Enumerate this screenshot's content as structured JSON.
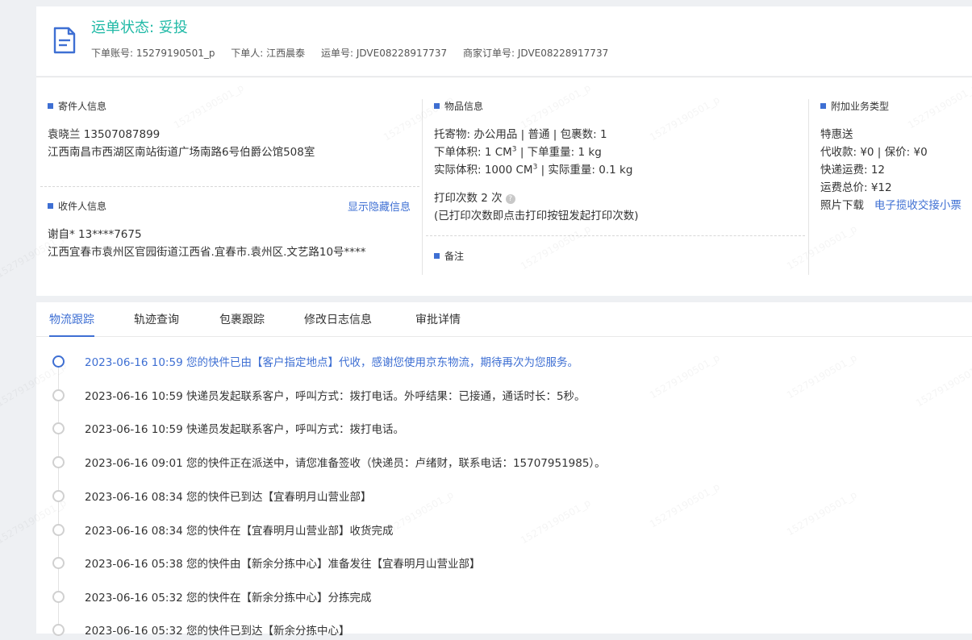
{
  "header": {
    "status_label": "运单状态: 妥投",
    "account": "下单账号: 15279190501_p",
    "orderer": "下单人: 江西晨泰",
    "waybill": "运单号: JDVE08228917737",
    "merchant_order": "商家订单号: JDVE08228917737"
  },
  "sender": {
    "title": "寄件人信息",
    "name_phone": "袁晓兰    13507087899",
    "address": "江西南昌市西湖区南站街道广场南路6号伯爵公馆508室"
  },
  "receiver": {
    "title": "收件人信息",
    "show_hidden": "显示隐藏信息",
    "name_phone": "谢自*    13****7675",
    "address": "江西宜春市袁州区官园街道江西省.宜春市.袁州区.文艺路10号****"
  },
  "goods": {
    "title": "物品信息",
    "line1": "托寄物:  办公用品 | 普通  |  包裹数:  1",
    "order_volume": "下单体积:   1 CM",
    "order_weight": " |  下单重量:   1 kg",
    "actual_volume": "实际体积:    1000 CM",
    "actual_weight": " |  实际重量:   0.1 kg",
    "cube": "3",
    "print_count": "打印次数    2 次",
    "print_note": "(已打印次数即点击打印按钮发起打印次数)",
    "remark_title": "备注"
  },
  "addon": {
    "title": "附加业务类型",
    "service": "特惠送",
    "cod": "代收款:  ¥0  |  保价:  ¥0",
    "freight": "快递运费:   12",
    "total": "运费总价:   ¥12",
    "photo_label": "照片下载",
    "photo_link": "电子揽收交接小票"
  },
  "tabs": [
    "物流跟踪",
    "轨迹查询",
    "包裹跟踪",
    "修改日志信息",
    "审批详情"
  ],
  "timeline": [
    "2023-06-16 10:59 您的快件已由【客户指定地点】代收，感谢您使用京东物流，期待再次为您服务。",
    "2023-06-16 10:59 快递员发起联系客户，呼叫方式：拨打电话。外呼结果：已接通，通话时长：5秒。",
    "2023-06-16 10:59 快递员发起联系客户，呼叫方式：拨打电话。",
    "2023-06-16 09:01 您的快件正在派送中，请您准备签收（快递员：卢绪财，联系电话：15707951985）。",
    "2023-06-16 08:34 您的快件已到达【宜春明月山营业部】",
    "2023-06-16 08:34 您的快件在【宜春明月山营业部】收货完成",
    "2023-06-16 05:38 您的快件由【新余分拣中心】准备发往【宜春明月山营业部】",
    "2023-06-16 05:32 您的快件在【新余分拣中心】分拣完成",
    "2023-06-16 05:32 您的快件已到达【新余分拣中心】"
  ],
  "watermark": "15279190501_p",
  "colors": {
    "accent": "#3e6fd3",
    "status": "#1fb9a6"
  }
}
